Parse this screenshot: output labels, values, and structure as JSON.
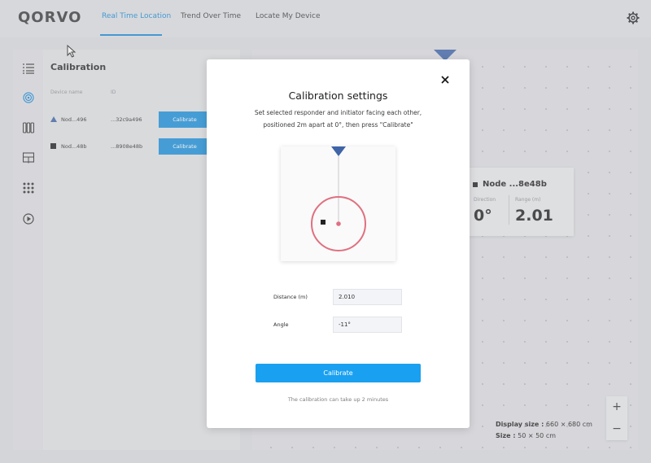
{
  "header": {
    "logo": "QORVO",
    "tabs": [
      {
        "label": "Real Time Location",
        "active": true
      },
      {
        "label": "Trend Over Time",
        "active": false
      },
      {
        "label": "Locate My Device",
        "active": false
      }
    ],
    "settings_icon": "gear-icon"
  },
  "rail": {
    "icons": [
      "list-icon",
      "target-icon",
      "devices-icon",
      "report-icon",
      "grid-icon",
      "play-icon"
    ]
  },
  "panel": {
    "title": "Calibration",
    "columns": [
      "Device name",
      "ID"
    ],
    "devices": [
      {
        "name": "Nod...496",
        "id": "...32c9a496",
        "marker": "triangle",
        "button": "Calibrate"
      },
      {
        "name": "Nod...48b",
        "id": "...8908e48b",
        "marker": "square",
        "button": "Calibrate"
      }
    ]
  },
  "node_card": {
    "title": "Node ...8e48b",
    "direction_label": "Direction",
    "direction_value": "0°",
    "range_label": "Range (m)",
    "range_value": "2.01"
  },
  "map_info": {
    "display_size_label": "Display size :",
    "display_size_value": "660 × 680 cm",
    "size_label": "Size :",
    "size_value": "50 × 50 cm",
    "zoom_in": "+",
    "zoom_out": "−"
  },
  "modal": {
    "title": "Calibration settings",
    "desc_line1": "Set selected responder and initiator facing each other,",
    "desc_line2": "positioned 2m apart at 0°, then press \"Calibrate\"",
    "distance_label": "Distance (m)",
    "distance_value": "2.010",
    "angle_label": "Angle",
    "angle_value": "-11°",
    "calibrate_label": "Calibrate",
    "footnote": "The calibration can take up 2 minutes"
  },
  "colors": {
    "accent": "#1a8ad6",
    "primary_button": "#1aa0f0",
    "initiator": "#3f64a8",
    "target_ring": "#e07080"
  }
}
